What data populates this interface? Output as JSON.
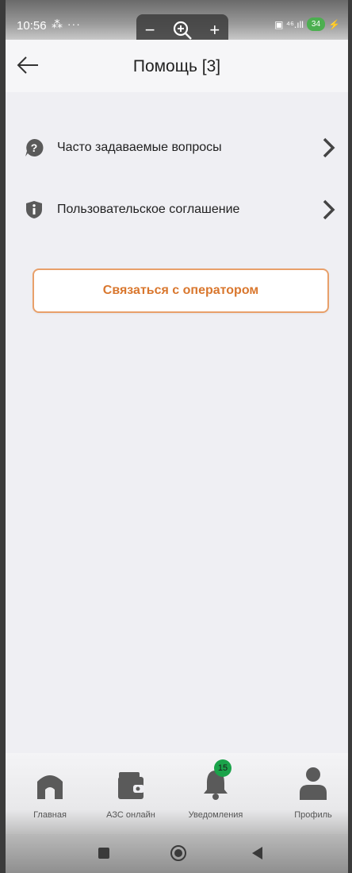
{
  "status_bar": {
    "time": "10:56",
    "icons_left": "⁂ ···",
    "icons_right": "▣ ⁴⁶.ıll",
    "battery": "34"
  },
  "zoom_control": {
    "minus": "−",
    "icon": "zoom-in-icon",
    "plus": "+"
  },
  "header": {
    "back_icon": "arrow-left-icon",
    "title": "Помощь [3]"
  },
  "menu": {
    "items": [
      {
        "label": "Часто задаваемые вопросы",
        "icon": "question-circle-icon"
      },
      {
        "label": "Пользовательское соглашение",
        "icon": "shield-info-icon"
      }
    ]
  },
  "contact_button": {
    "label": "Связаться с оператором"
  },
  "bottom_nav": {
    "items": [
      {
        "label": "Главная",
        "icon": "home-icon"
      },
      {
        "label": "АЗС онлайн",
        "icon": "wallet-icon"
      },
      {
        "label": "Уведомления",
        "icon": "bell-icon",
        "badge": "15"
      },
      {
        "label": "Профиль",
        "icon": "user-icon"
      }
    ]
  },
  "colors": {
    "accent": "#d9772e",
    "accent_border": "#e8a06a",
    "badge": "#1aa34a",
    "icon_gray": "#5a5a5a"
  }
}
